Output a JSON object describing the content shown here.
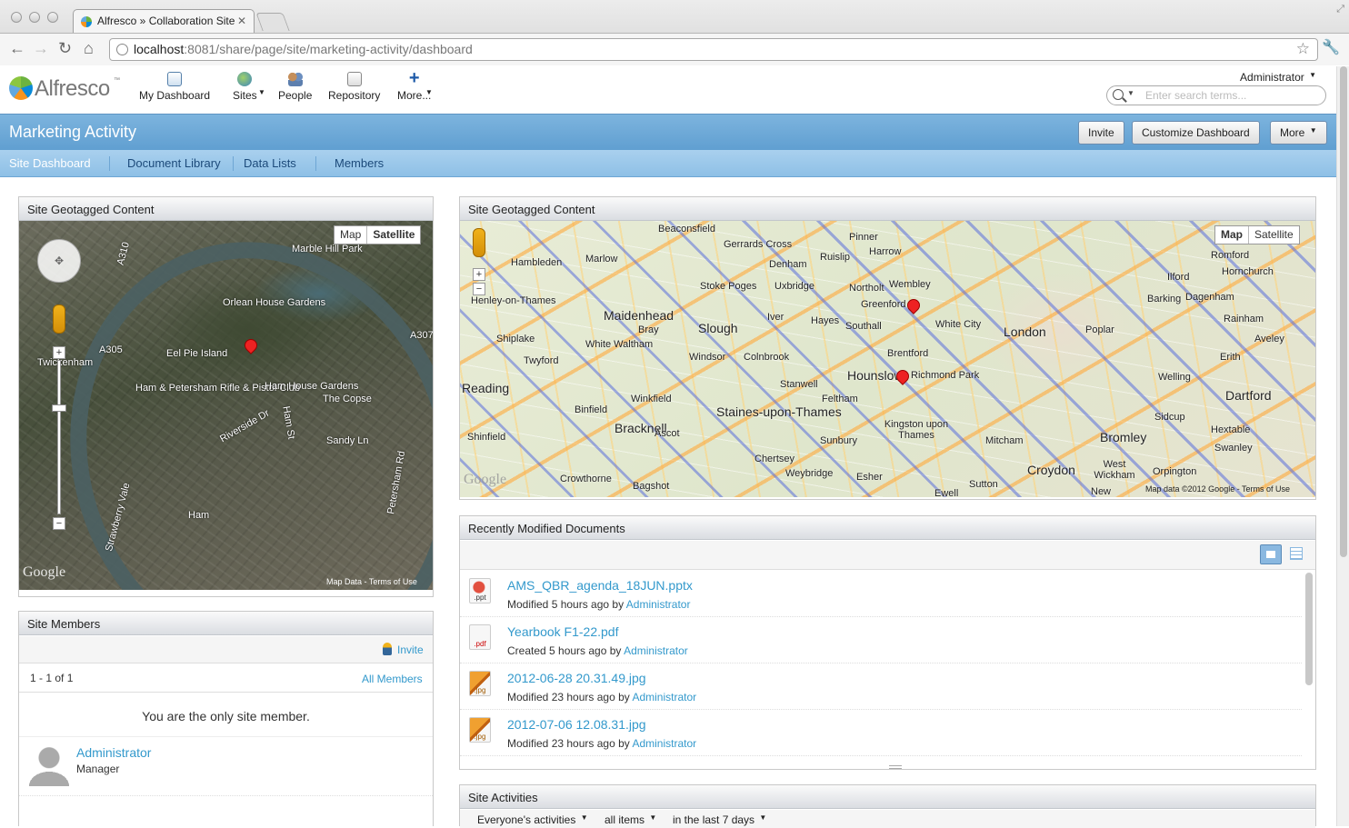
{
  "browser": {
    "tab_title": "Alfresco » Collaboration Site",
    "url_host": "localhost",
    "url_rest": ":8081/share/page/site/marketing-activity/dashboard"
  },
  "app": {
    "logo": "Alfresco",
    "logo_tm": "™",
    "nav": [
      {
        "label": "My Dashboard"
      },
      {
        "label": "Sites"
      },
      {
        "label": "People"
      },
      {
        "label": "Repository"
      },
      {
        "label": "More..."
      }
    ],
    "user": "Administrator",
    "search_placeholder": "Enter search terms..."
  },
  "site": {
    "title": "Marketing Activity",
    "buttons": {
      "invite": "Invite",
      "customize": "Customize Dashboard",
      "more": "More"
    },
    "nav": [
      "Site Dashboard",
      "Document Library",
      "Data Lists",
      "Members"
    ]
  },
  "geo_left": {
    "title": "Site Geotagged Content",
    "map_btn": "Map",
    "sat_btn": "Satellite",
    "labels": [
      "Marble Hill Park",
      "Orlean House Gardens",
      "Eel Pie Island",
      "Twickenham",
      "Ham & Petersham Rifle & Pistol Club",
      "Ham House Gardens",
      "The Copse",
      "Riverside Dr",
      "Ham St",
      "Sandy Ln",
      "Petersham Rd",
      "Ham",
      "Strawberry Vale",
      "A310",
      "A305",
      "A307"
    ],
    "google": "Google",
    "copyright": "Map Data - Terms of Use"
  },
  "geo_right": {
    "title": "Site Geotagged Content",
    "map_btn": "Map",
    "sat_btn": "Satellite",
    "labels": [
      "Beaconsfield",
      "Gerrards Cross",
      "Marlow",
      "Hambleden",
      "Henley-on-Thames",
      "Maidenhead",
      "Slough",
      "Stoke Poges",
      "Uxbridge",
      "Denham",
      "Pinner",
      "Harrow",
      "Ruislip",
      "Northolt",
      "Wembley",
      "Greenford",
      "Southall",
      "Hayes",
      "Iver",
      "White City",
      "London",
      "Brentford",
      "Hounslow",
      "Richmond Park",
      "Feltham",
      "Stanwell",
      "Staines-upon-Thames",
      "Windsor",
      "Colnbrook",
      "Bray",
      "White Waltham",
      "Twyford",
      "Shiplake",
      "Binfield",
      "Winkfield",
      "Bracknell",
      "Ascot",
      "Shinfield",
      "Sunbury",
      "Chertsey",
      "Weybridge",
      "Esher",
      "Kingston upon Thames",
      "Mitcham",
      "Croydon",
      "Sutton",
      "Bromley",
      "West Wickham",
      "Orpington",
      "Sidcup",
      "Hextable",
      "Swanley",
      "Dartford",
      "Welling",
      "Erith",
      "Aveley",
      "Rainham",
      "Dagenham",
      "Barking",
      "Ilford",
      "Romford",
      "Hornchurch",
      "Poplar",
      "Crowthorne",
      "Bagshot",
      "Ewell",
      "New",
      "Reading"
    ],
    "google": "Google",
    "copyright": "Map data ©2012 Google - Terms of Use"
  },
  "members": {
    "title": "Site Members",
    "invite": "Invite",
    "count": "1 - 1 of 1",
    "all": "All Members",
    "message": "You are the only site member.",
    "list": [
      {
        "name": "Administrator",
        "role": "Manager"
      }
    ]
  },
  "docs": {
    "title": "Recently Modified Documents",
    "items": [
      {
        "name": "AMS_QBR_agenda_18JUN.pptx",
        "ext": ".ppt",
        "meta": "Modified 5 hours ago by",
        "user": "Administrator"
      },
      {
        "name": "Yearbook F1-22.pdf",
        "ext": ".pdf",
        "meta": "Created 5 hours ago by",
        "user": "Administrator"
      },
      {
        "name": "2012-06-28 20.31.49.jpg",
        "ext": ".jpg",
        "meta": "Modified 23 hours ago by",
        "user": "Administrator"
      },
      {
        "name": "2012-07-06 12.08.31.jpg",
        "ext": ".jpg",
        "meta": "Modified 23 hours ago by",
        "user": "Administrator"
      }
    ]
  },
  "activities": {
    "title": "Site Activities",
    "filters": [
      "Everyone's activities",
      "all items",
      "in the last 7 days"
    ]
  }
}
